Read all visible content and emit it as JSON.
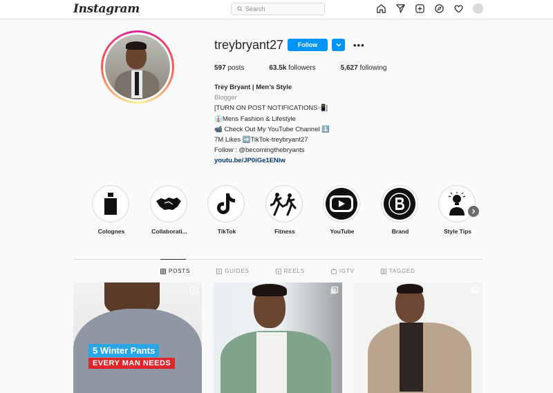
{
  "app": {
    "logo_text": "Instagram",
    "search_placeholder": "Search"
  },
  "nav_icons": [
    "home-icon",
    "direct-icon",
    "new-post-icon",
    "explore-icon",
    "activity-heart-icon",
    "profile-avatar"
  ],
  "profile": {
    "username": "treybryant27",
    "follow_label": "Follow",
    "stats": {
      "posts": "597",
      "posts_label": "posts",
      "followers": "63.5k",
      "followers_label": "followers",
      "following": "5,627",
      "following_label": "following"
    },
    "bio": {
      "name": "Trey Bryant | Men’s Style",
      "category": "Blogger",
      "lines": [
        "[TURN ON POST NOTIFICATIONS📲]",
        "👔Mens Fashion & Lifestyle",
        "📹 Check Out My YouTube Channel ⬇️",
        "7M Likes ➡️TikTok-treybryant27",
        "Follow : @becomingthebryants"
      ],
      "link": "youtu.be/JP0iGe1ENiw"
    }
  },
  "highlights": [
    {
      "label": "Colognes",
      "icon": "cologne-bottle-icon"
    },
    {
      "label": "Collaborati...",
      "icon": "handshake-icon"
    },
    {
      "label": "TikTok",
      "icon": "tiktok-icon"
    },
    {
      "label": "Fitness",
      "icon": "runners-icon"
    },
    {
      "label": "YouTube",
      "icon": "youtube-icon"
    },
    {
      "label": "Brand",
      "icon": "brand-b-icon"
    },
    {
      "label": "Style Tips",
      "icon": "lightbulb-person-icon"
    }
  ],
  "tabs": [
    {
      "label": "POSTS",
      "active": true
    },
    {
      "label": "GUIDES",
      "active": false
    },
    {
      "label": "REELS",
      "active": false
    },
    {
      "label": "IGTV",
      "active": false
    },
    {
      "label": "TAGGED",
      "active": false
    }
  ],
  "posts": [
    {
      "banner_top": "5 Winter Pants",
      "banner_bottom": "EVERY MAN NEEDS",
      "type_icon": "reel-icon"
    },
    {
      "type_icon": "carousel-icon"
    },
    {
      "type_icon": "carousel-icon"
    }
  ],
  "colors": {
    "accent": "#0095f6",
    "text": "#262626",
    "muted": "#8e8e8e",
    "link": "#00376b"
  }
}
